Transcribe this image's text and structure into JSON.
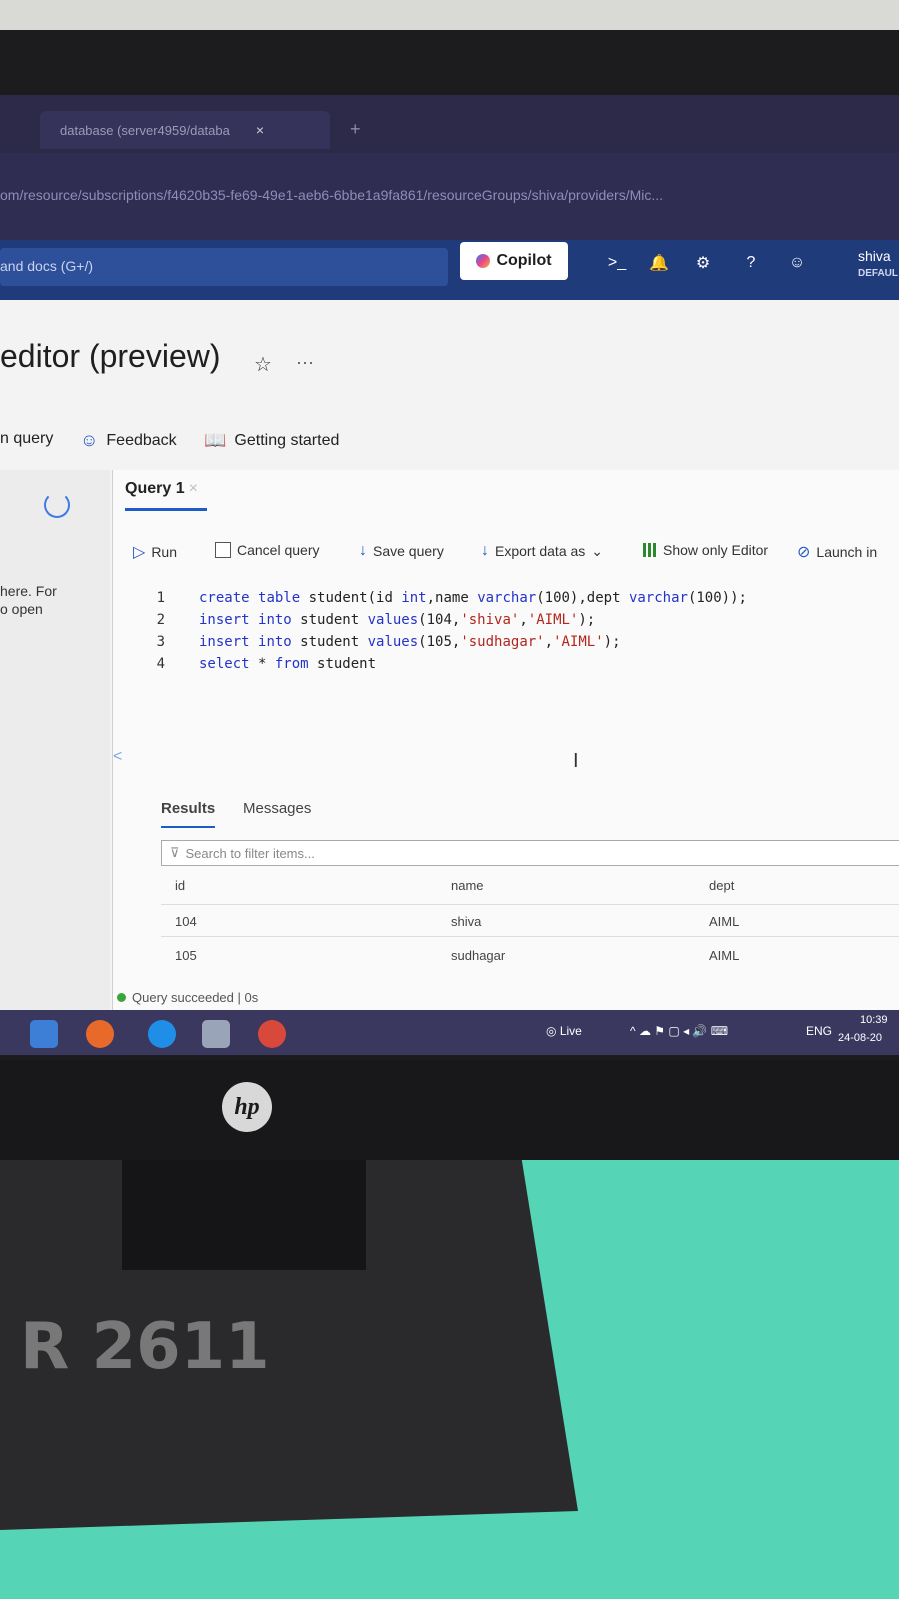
{
  "browser": {
    "tab_title": "database (server4959/databa",
    "tab_close": "×",
    "tab_new": "+",
    "url": "om/resource/subscriptions/f4620b35-fe69-49e1-aeb6-6bbe1a9fa861/resourceGroups/shiva/providers/Mic..."
  },
  "portal": {
    "search_placeholder": "and docs (G+/)",
    "copilot_label": "Copilot",
    "user_name": "shiva",
    "user_directory": "DEFAUL"
  },
  "page": {
    "title": "editor (preview)",
    "more": "···",
    "commands": [
      "n query",
      "Feedback",
      "Getting started"
    ]
  },
  "sidebar": {
    "text_line1": "here. For",
    "text_line2": "o open"
  },
  "editor": {
    "tab_label": "Query 1",
    "tab_close": "×",
    "toolbar": {
      "run": "Run",
      "cancel": "Cancel query",
      "save": "Save query",
      "export": "Export data as",
      "show_only_editor": "Show only Editor",
      "launch": "Launch in"
    },
    "lines": [
      {
        "n": "1",
        "tokens": [
          [
            "kw",
            "create"
          ],
          [
            "tx",
            " "
          ],
          [
            "kw",
            "table"
          ],
          [
            "tx",
            " student(id "
          ],
          [
            "kw",
            "int"
          ],
          [
            "tx",
            ",name "
          ],
          [
            "kw",
            "varchar"
          ],
          [
            "tx",
            "(100),dept "
          ],
          [
            "kw",
            "varchar"
          ],
          [
            "tx",
            "(100));"
          ]
        ]
      },
      {
        "n": "2",
        "tokens": [
          [
            "kw",
            "insert"
          ],
          [
            "tx",
            " "
          ],
          [
            "kw",
            "into"
          ],
          [
            "tx",
            " student "
          ],
          [
            "kw",
            "values"
          ],
          [
            "tx",
            "(104,"
          ],
          [
            "st",
            "'shiva'"
          ],
          [
            "tx",
            ","
          ],
          [
            "st",
            "'AIML'"
          ],
          [
            "tx",
            ");"
          ]
        ]
      },
      {
        "n": "3",
        "tokens": [
          [
            "kw",
            "insert"
          ],
          [
            "tx",
            " "
          ],
          [
            "kw",
            "into"
          ],
          [
            "tx",
            " student "
          ],
          [
            "kw",
            "values"
          ],
          [
            "tx",
            "(105,"
          ],
          [
            "st",
            "'sudhagar'"
          ],
          [
            "tx",
            ","
          ],
          [
            "st",
            "'AIML'"
          ],
          [
            "tx",
            ");"
          ]
        ]
      },
      {
        "n": "4",
        "tokens": [
          [
            "kw",
            "select"
          ],
          [
            "tx",
            " * "
          ],
          [
            "kw",
            "from"
          ],
          [
            "tx",
            " student"
          ]
        ]
      }
    ]
  },
  "results": {
    "tab_results": "Results",
    "tab_messages": "Messages",
    "filter_placeholder": "Search to filter items...",
    "columns": [
      "id",
      "name",
      "dept"
    ],
    "rows": [
      [
        "104",
        "shiva",
        "AIML"
      ],
      [
        "105",
        "sudhagar",
        "AIML"
      ]
    ],
    "status": "Query succeeded | 0s"
  },
  "taskbar": {
    "live": "Live",
    "lang": "ENG",
    "time": "10:39",
    "date": "24-08-20"
  },
  "monitor": {
    "brand": "hp"
  },
  "colors": {
    "keyword": "#2433c9",
    "string": "#b3261e",
    "accent": "#1e5bc6",
    "portal_bar": "#1f3b7a"
  }
}
